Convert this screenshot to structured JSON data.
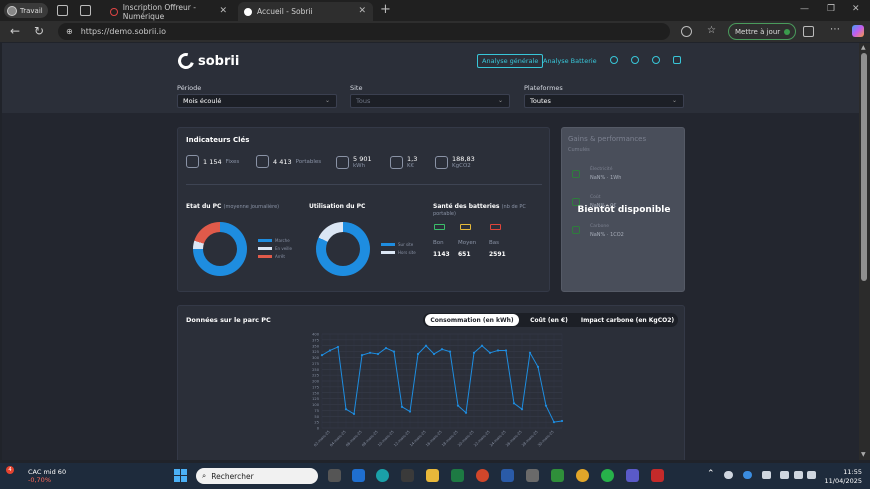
{
  "browser": {
    "profile_label": "Travail",
    "tabs": [
      {
        "title": "Inscription Offreur - Numérique"
      },
      {
        "title": "Accueil - Sobrii"
      }
    ],
    "url": "https://demo.sobrii.io",
    "update_label": "Mettre à jour"
  },
  "app": {
    "logo_text": "sobrii",
    "nav": {
      "general_label": "Analyse générale",
      "battery_label": "Analyse Batterie"
    },
    "filters": {
      "period": {
        "label": "Période",
        "value": "Mois écoulé"
      },
      "site": {
        "label": "Site",
        "value": "Tous"
      },
      "platforms": {
        "label": "Plateformes",
        "value": "Toutes"
      }
    },
    "indicators": {
      "title": "Indicateurs Clés",
      "kpis": [
        {
          "value": "1 154",
          "unit": "Fixes",
          "icon": "desktop-icon"
        },
        {
          "value": "4 413",
          "unit": "Portables",
          "icon": "laptop-icon"
        },
        {
          "value": "5 901",
          "unit": "kWh",
          "icon": "plug-icon"
        },
        {
          "value": "1,3",
          "unit": "K€",
          "icon": "coins-icon"
        },
        {
          "value": "188,83",
          "unit": "KgCO2",
          "icon": "leaf-icon"
        }
      ],
      "pc_state": {
        "title": "Etat du PC",
        "subtitle": "(moyenne journalière)",
        "legend": [
          "Marche",
          "En veille",
          "Arrêt"
        ],
        "values": [
          0.75,
          0.05,
          0.2
        ],
        "colors": [
          "#1e8de0",
          "#dbe6f4",
          "#e05a4a"
        ]
      },
      "pc_usage": {
        "title": "Utilisation du PC",
        "legend": [
          "Sur site",
          "Hors site"
        ],
        "values": [
          0.82,
          0.18
        ],
        "colors": [
          "#1e8de0",
          "#dbe6f4"
        ]
      },
      "battery_health": {
        "title": "Santé des batteries",
        "subtitle": "(nb de PC portable)",
        "items": [
          {
            "label": "Bon",
            "value": "1143",
            "color": "#3bbf6a"
          },
          {
            "label": "Moyen",
            "value": "651",
            "color": "#e6b93a"
          },
          {
            "label": "Bas",
            "value": "2591",
            "color": "#e0453a"
          }
        ]
      }
    },
    "gains": {
      "title": "Gains & performances",
      "subtitle": "Cumulés",
      "items": [
        {
          "label": "Électricité",
          "value": "NaN% · 1Wh"
        },
        {
          "label": "Coût",
          "value": "NaN% · 0€"
        },
        {
          "label": "Carbone",
          "value": "NaN% · 1CO2"
        }
      ],
      "overlay": "Bientôt disponible"
    },
    "chart_section": {
      "title": "Données sur le parc PC",
      "segments": [
        "Consommation (en kWh)",
        "Coût (en €)",
        "Impact carbone (en KgCO2)"
      ],
      "active_segment": 0
    }
  },
  "chart_data": {
    "type": "line",
    "title": "",
    "xlabel": "",
    "ylabel": "",
    "ylim": [
      0,
      400
    ],
    "yticks": [
      0,
      25,
      50,
      75,
      100,
      125,
      150,
      175,
      200,
      225,
      250,
      275,
      300,
      325,
      350,
      375,
      400
    ],
    "x": [
      "01-mars-25",
      "02-mars-25",
      "03-mars-25",
      "04-mars-25",
      "05-mars-25",
      "06-mars-25",
      "07-mars-25",
      "08-mars-25",
      "09-mars-25",
      "10-mars-25",
      "11-mars-25",
      "12-mars-25",
      "13-mars-25",
      "14-mars-25",
      "15-mars-25",
      "16-mars-25",
      "17-mars-25",
      "18-mars-25",
      "19-mars-25",
      "20-mars-25",
      "21-mars-25",
      "22-mars-25",
      "23-mars-25",
      "24-mars-25",
      "25-mars-25",
      "26-mars-25",
      "27-mars-25",
      "28-mars-25",
      "29-mars-25",
      "30-mars-25",
      "31-mars-25"
    ],
    "x_ticks_shown": [
      "02-mars-25",
      "04-mars-25",
      "06-mars-25",
      "08-mars-25",
      "10-mars-25",
      "12-mars-25",
      "14-mars-25",
      "16-mars-25",
      "18-mars-25",
      "20-mars-25",
      "22-mars-25",
      "24-mars-25",
      "26-mars-25",
      "28-mars-25",
      "30-mars-25"
    ],
    "series": [
      {
        "values": [
          310,
          330,
          345,
          80,
          60,
          310,
          320,
          315,
          340,
          325,
          90,
          70,
          315,
          350,
          315,
          335,
          325,
          95,
          65,
          320,
          350,
          320,
          330,
          330,
          105,
          80,
          320,
          260,
          95,
          25,
          30
        ],
        "color": "#1e8de0"
      }
    ],
    "grid": true,
    "legend": "none"
  },
  "taskbar": {
    "stock_name": "CAC mid 60",
    "stock_change": "-0,70%",
    "stock_badge": "4",
    "search_placeholder": "Rechercher",
    "time": "11:55",
    "date": "11/04/2025"
  }
}
